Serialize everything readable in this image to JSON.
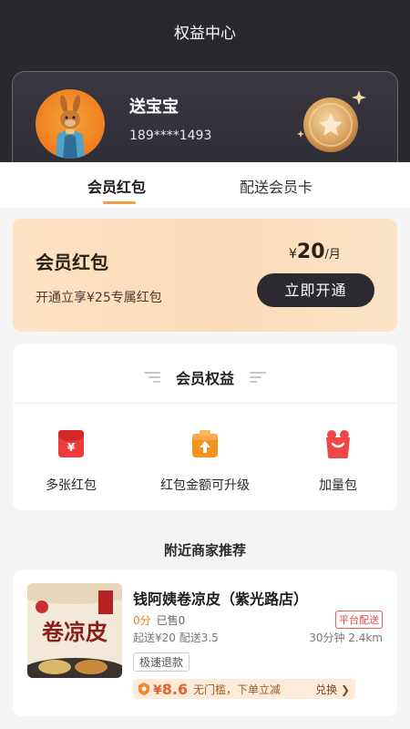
{
  "header": {
    "title": "权益中心"
  },
  "user": {
    "name": "送宝宝",
    "phone": "189****1493"
  },
  "tabs": [
    {
      "label": "会员红包",
      "active": true
    },
    {
      "label": "配送会员卡",
      "active": false
    }
  ],
  "offer": {
    "title": "会员红包",
    "subtitle": "开通立享¥25专属红包",
    "currency": "¥",
    "price": "20",
    "period": "/月",
    "button_label": "立即开通"
  },
  "benefits": {
    "heading": "会员权益",
    "items": [
      {
        "label": "多张红包",
        "icon": "red-envelope-icon"
      },
      {
        "label": "红包金额可升级",
        "icon": "upgrade-icon"
      },
      {
        "label": "加量包",
        "icon": "gift-bag-icon"
      }
    ]
  },
  "nearby": {
    "heading": "附近商家推荐"
  },
  "store": {
    "name": "钱阿姨卷凉皮（紫光路店）",
    "score": "0分",
    "sold": "已售0",
    "tag": "平台配送",
    "fees": "起送¥20 配送3.5",
    "distance": "30分钟 2.4km",
    "refund": "极速退款",
    "coupon": {
      "currency": "¥",
      "amount": "8.6",
      "desc": "无门槛，下单立减",
      "action": "兑换 ❯"
    },
    "image_text": "卷凉皮"
  },
  "colors": {
    "header_bg": "#2a282f",
    "accent_orange": "#f0a04a",
    "offer_bg": "#fde2c4",
    "button_dark": "#2c2a30",
    "coupon_red": "#e3632a"
  }
}
